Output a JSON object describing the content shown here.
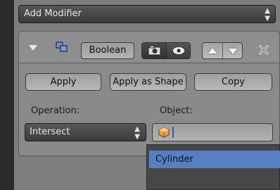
{
  "add_modifier": {
    "label": "Add Modifier",
    "arrows_icon": "up-down-arrows-icon"
  },
  "modifier": {
    "name": "Boolean",
    "move_up_icon": "triangle-up-icon",
    "move_down_icon": "triangle-down-icon",
    "close_glyph": "✕"
  },
  "actions": {
    "apply": "Apply",
    "apply_as_shape": "Apply as Shape",
    "copy": "Copy"
  },
  "operation": {
    "label": "Operation:",
    "value": "Intersect"
  },
  "object": {
    "label": "Object:",
    "value": ""
  },
  "popup": {
    "items": [
      {
        "label": "Cylinder",
        "highlighted": true
      }
    ]
  },
  "colors": {
    "highlight": "#5680c2",
    "dark_field": "#474747",
    "panel": "#8a8a8a"
  }
}
